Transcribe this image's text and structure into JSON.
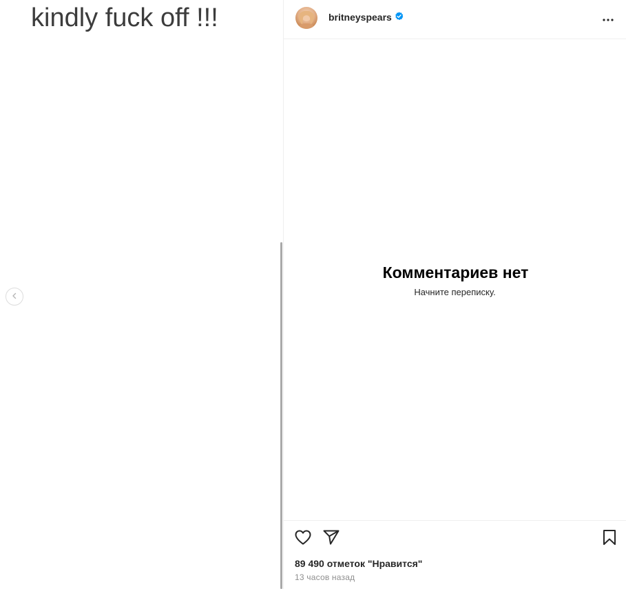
{
  "post": {
    "image_text": "kindly fuck off !!!"
  },
  "header": {
    "username": "britneyspears",
    "verified": true,
    "verified_color": "#0095f6"
  },
  "comments": {
    "empty_title": "Комментариев нет",
    "empty_subtitle": "Начните переписку."
  },
  "footer": {
    "likes": "89 490 отметок \"Нравится\"",
    "time": "13 часов назад"
  },
  "icons": {
    "prev": "chevron-left-icon",
    "more": "more-horizontal-icon",
    "like": "heart-icon",
    "share": "send-icon",
    "save": "bookmark-icon",
    "verified": "verified-badge-icon"
  }
}
